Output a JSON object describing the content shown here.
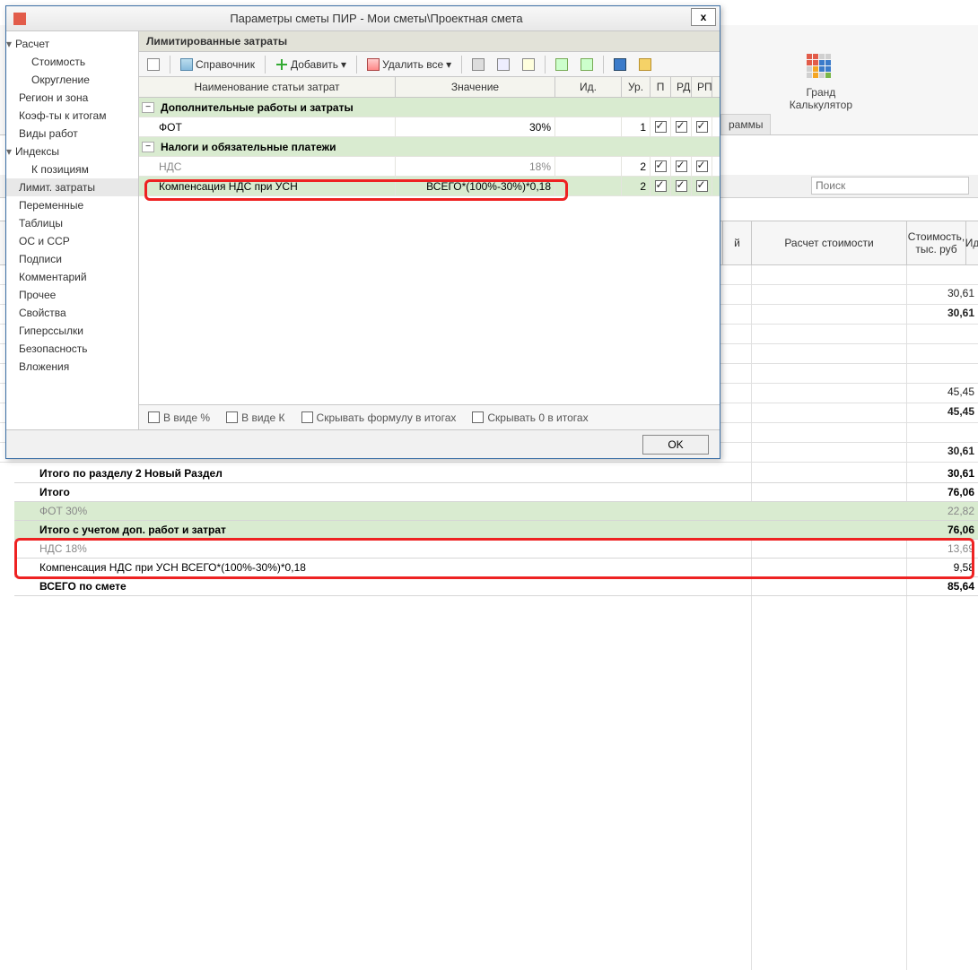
{
  "dialog": {
    "title": "Параметры сметы ПИР - Мои сметы\\Проектная смета",
    "close": "x",
    "section": "Лимитированные затраты",
    "ok": "OK",
    "toolbar": {
      "ref": "Справочник",
      "add": "Добавить",
      "del": "Удалить все"
    },
    "tree": [
      {
        "l": 1,
        "caret": "▾",
        "t": "Расчет"
      },
      {
        "l": 2,
        "t": "Стоимость"
      },
      {
        "l": 2,
        "t": "Округление"
      },
      {
        "l": 1,
        "t": "Регион и зона"
      },
      {
        "l": 1,
        "t": "Коэф-ты к итогам"
      },
      {
        "l": 1,
        "t": "Виды работ"
      },
      {
        "l": 1,
        "caret": "▾",
        "t": "Индексы"
      },
      {
        "l": 2,
        "t": "К позициям"
      },
      {
        "l": 1,
        "t": "Лимит. затраты",
        "sel": true
      },
      {
        "l": 1,
        "t": "Переменные"
      },
      {
        "l": 1,
        "t": "Таблицы"
      },
      {
        "l": 1,
        "t": "ОС и ССР"
      },
      {
        "l": 1,
        "t": "Подписи"
      },
      {
        "l": 1,
        "t": "Комментарий"
      },
      {
        "l": 1,
        "t": "Прочее"
      },
      {
        "l": 1,
        "t": "Свойства"
      },
      {
        "l": 1,
        "t": "Гиперссылки"
      },
      {
        "l": 1,
        "t": "Безопасность"
      },
      {
        "l": 1,
        "t": "Вложения"
      }
    ],
    "cols": {
      "name": "Наименование статьи затрат",
      "val": "Значение",
      "id": "Ид.",
      "lvl": "Ур.",
      "p": "П",
      "rd": "РД",
      "rp": "РП"
    },
    "rows": [
      {
        "grp": true,
        "name": "Дополнительные работы и затраты"
      },
      {
        "name": "ФОТ",
        "val": "30%",
        "lvl": "1",
        "p": true,
        "rd": true,
        "rp": true
      },
      {
        "grp": true,
        "name": "Налоги и обязательные платежи"
      },
      {
        "name": "НДС",
        "val": "18%",
        "lvl": "2",
        "p": true,
        "rd": true,
        "rp": true,
        "grey": true
      },
      {
        "name": "Компенсация НДС при УСН",
        "val": "ВСЕГО*(100%-30%)*0,18",
        "lvl": "2",
        "p": true,
        "rd": true,
        "rp": true,
        "hl": true
      }
    ],
    "opts": {
      "pct": "В виде %",
      "k": "В виде К",
      "hideForm": "Скрывать формулу в итогах",
      "hideZero": "Скрывать 0 в итогах"
    }
  },
  "ribbon": {
    "calc1": "Гранд",
    "calc2": "Калькулятор",
    "tab": "раммы"
  },
  "search": {
    "ph": "Поиск"
  },
  "bgcols": {
    "y": "й",
    "calc": "Расчет стоимости",
    "cost": "Стоимость, тыс. руб",
    "id": "Ид"
  },
  "bgvals": [
    "",
    "30,61",
    "30,61",
    "",
    "",
    "",
    "45,45",
    "45,45",
    "",
    "30,61"
  ],
  "bottom": [
    {
      "bold": true,
      "label": "Итого по разделу 2 Новый Раздел",
      "val": "30,61"
    },
    {
      "bold": true,
      "label": "Итого",
      "val": "76,06"
    },
    {
      "green": true,
      "grey": true,
      "label": "ФОТ 30%",
      "val": "22,82"
    },
    {
      "bold": true,
      "green": true,
      "label": "Итого с учетом доп. работ и затрат",
      "val": "76,06"
    },
    {
      "grey": true,
      "label": "НДС 18%",
      "val": "13,69"
    },
    {
      "label": "Компенсация НДС при УСН ВСЕГО*(100%-30%)*0,18",
      "val": "9,58"
    },
    {
      "bold": true,
      "label": "ВСЕГО по смете",
      "val": "85,64"
    }
  ]
}
